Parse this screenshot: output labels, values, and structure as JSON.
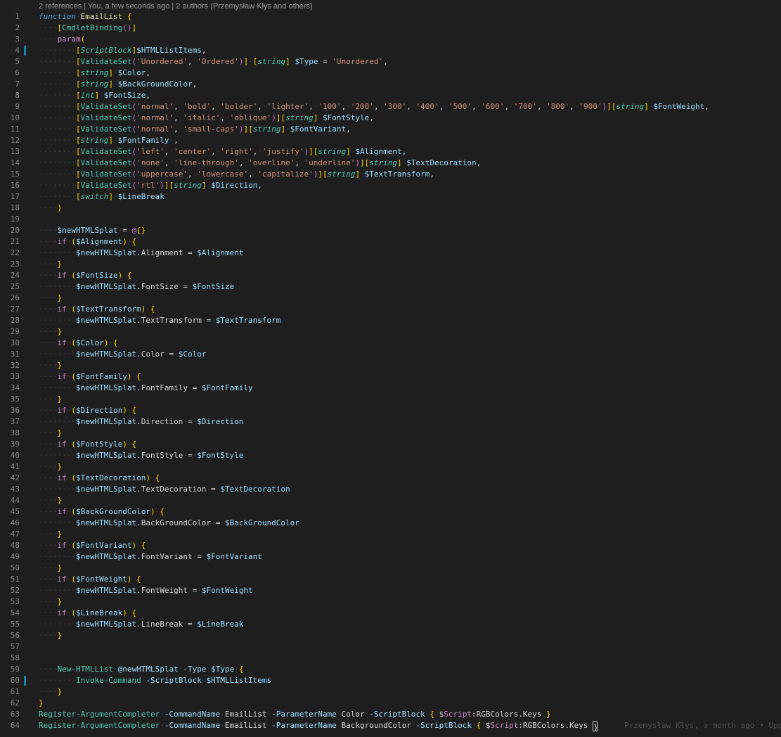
{
  "codelens": "2 references | You, a few seconds ago | 2 authors (Przemysław Kłys and others)",
  "colors": {
    "background": "#1e1e1e",
    "line_number": "#858585",
    "modified_marker": "#1b81a8"
  },
  "modified_lines": [
    4,
    60
  ],
  "blame_line": 64,
  "blame_text": "Przemysław Kłys, a month ago • Upg",
  "cursor_line": 64,
  "lines": [
    {
      "n": "1",
      "text": "function EmailList {"
    },
    {
      "n": "2",
      "text": "    [CmdletBinding()]"
    },
    {
      "n": "3",
      "text": "    param("
    },
    {
      "n": "4",
      "text": "        [ScriptBlock]$HTMLListItems,"
    },
    {
      "n": "5",
      "text": "        [ValidateSet('Unordered', 'Ordered')] [string] $Type = 'Unordered',"
    },
    {
      "n": "6",
      "text": "        [string] $Color,"
    },
    {
      "n": "7",
      "text": "        [string] $BackGroundColor,"
    },
    {
      "n": "8",
      "text": "        [int] $FontSize,"
    },
    {
      "n": "9",
      "text": "        [ValidateSet('normal', 'bold', 'bolder', 'lighter', '100', '200', '300', '400', '500', '600', '700', '800', '900')][string] $FontWeight,"
    },
    {
      "n": "10",
      "text": "        [ValidateSet('normal', 'italic', 'oblique')][string] $FontStyle,"
    },
    {
      "n": "11",
      "text": "        [ValidateSet('normal', 'small-caps')][string] $FontVariant,"
    },
    {
      "n": "12",
      "text": "        [string] $FontFamily ,"
    },
    {
      "n": "13",
      "text": "        [ValidateSet('left', 'center', 'right', 'justify')][string] $Alignment,"
    },
    {
      "n": "14",
      "text": "        [ValidateSet('none', 'line-through', 'overline', 'underline')][string] $TextDecoration,"
    },
    {
      "n": "15",
      "text": "        [ValidateSet('uppercase', 'lowercase', 'capitalize')][string] $TextTransform,"
    },
    {
      "n": "16",
      "text": "        [ValidateSet('rtl')][string] $Direction,"
    },
    {
      "n": "17",
      "text": "        [switch] $LineBreak"
    },
    {
      "n": "18",
      "text": "    )"
    },
    {
      "n": "19",
      "text": ""
    },
    {
      "n": "20",
      "text": "    $newHTMLSplat = @{}"
    },
    {
      "n": "21",
      "text": "    if ($Alignment) {"
    },
    {
      "n": "22",
      "text": "        $newHTMLSplat.Alignment = $Alignment"
    },
    {
      "n": "23",
      "text": "    }"
    },
    {
      "n": "24",
      "text": "    if ($FontSize) {"
    },
    {
      "n": "25",
      "text": "        $newHTMLSplat.FontSize = $FontSize"
    },
    {
      "n": "26",
      "text": "    }"
    },
    {
      "n": "27",
      "text": "    if ($TextTransform) {"
    },
    {
      "n": "28",
      "text": "        $newHTMLSplat.TextTransform = $TextTransform"
    },
    {
      "n": "29",
      "text": "    }"
    },
    {
      "n": "30",
      "text": "    if ($Color) {"
    },
    {
      "n": "31",
      "text": "        $newHTMLSplat.Color = $Color"
    },
    {
      "n": "32",
      "text": "    }"
    },
    {
      "n": "33",
      "text": "    if ($FontFamily) {"
    },
    {
      "n": "34",
      "text": "        $newHTMLSplat.FontFamily = $FontFamily"
    },
    {
      "n": "35",
      "text": "    }"
    },
    {
      "n": "36",
      "text": "    if ($Direction) {"
    },
    {
      "n": "37",
      "text": "        $newHTMLSplat.Direction = $Direction"
    },
    {
      "n": "38",
      "text": "    }"
    },
    {
      "n": "39",
      "text": "    if ($FontStyle) {"
    },
    {
      "n": "40",
      "text": "        $newHTMLSplat.FontStyle = $FontStyle"
    },
    {
      "n": "41",
      "text": "    }"
    },
    {
      "n": "42",
      "text": "    if ($TextDecoration) {"
    },
    {
      "n": "43",
      "text": "        $newHTMLSplat.TextDecoration = $TextDecoration"
    },
    {
      "n": "44",
      "text": "    }"
    },
    {
      "n": "45",
      "text": "    if ($BackGroundColor) {"
    },
    {
      "n": "46",
      "text": "        $newHTMLSplat.BackGroundColor = $BackGroundColor"
    },
    {
      "n": "47",
      "text": "    }"
    },
    {
      "n": "48",
      "text": "    if ($FontVariant) {"
    },
    {
      "n": "49",
      "text": "        $newHTMLSplat.FontVariant = $FontVariant"
    },
    {
      "n": "50",
      "text": "    }"
    },
    {
      "n": "51",
      "text": "    if ($FontWeight) {"
    },
    {
      "n": "52",
      "text": "        $newHTMLSplat.FontWeight = $FontWeight"
    },
    {
      "n": "53",
      "text": "    }"
    },
    {
      "n": "54",
      "text": "    if ($LineBreak) {"
    },
    {
      "n": "55",
      "text": "        $newHTMLSplat.LineBreak = $LineBreak"
    },
    {
      "n": "56",
      "text": "    }"
    },
    {
      "n": "57",
      "text": ""
    },
    {
      "n": "58",
      "text": ""
    },
    {
      "n": "59",
      "text": "    New-HTMLList @newHTMLSplat -Type $Type {"
    },
    {
      "n": "60",
      "text": "        Invoke-Command -ScriptBlock $HTMLListItems"
    },
    {
      "n": "61",
      "text": "    }"
    },
    {
      "n": "62",
      "text": "}"
    },
    {
      "n": "63",
      "text": "Register-ArgumentCompleter -CommandName EmailList -ParameterName Color -ScriptBlock { $Script:RGBColors.Keys }"
    },
    {
      "n": "64",
      "text": "Register-ArgumentCompleter -CommandName EmailList -ParameterName BackgroundColor -ScriptBlock { $Script:RGBColors.Keys }"
    }
  ]
}
